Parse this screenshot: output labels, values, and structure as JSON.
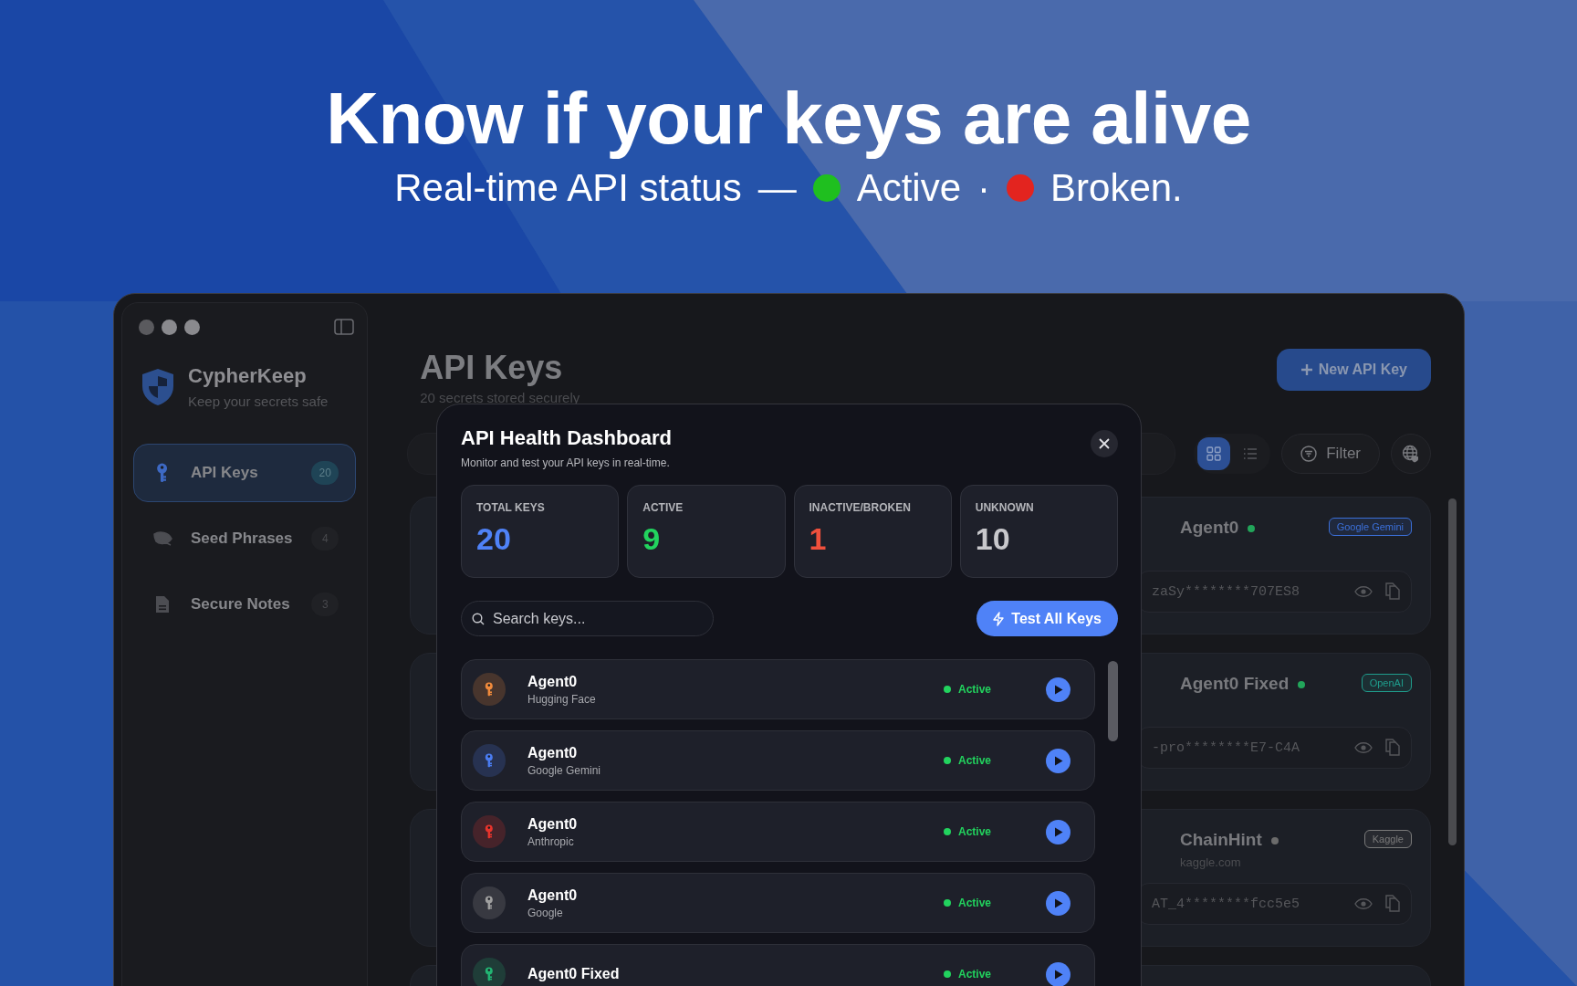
{
  "hero": {
    "title": "Know if your keys are alive",
    "subtitle": "Real-time API status",
    "dash": "—",
    "separator": "·",
    "statuses": [
      {
        "label": "Active",
        "color": "#1fbf1f"
      },
      {
        "label": "Broken.",
        "color": "#e3241f"
      }
    ]
  },
  "sidebar": {
    "app_name": "CypherKeep",
    "tagline": "Keep your secrets safe",
    "items": [
      {
        "label": "API Keys",
        "count": "20",
        "selected": true,
        "kind": "key"
      },
      {
        "label": "Seed Phrases",
        "count": "4",
        "selected": false,
        "kind": "leaf"
      },
      {
        "label": "Secure Notes",
        "count": "3",
        "selected": false,
        "kind": "note"
      }
    ]
  },
  "main": {
    "title": "API Keys",
    "subtitle": "20 secrets stored securely",
    "new_button": "New API Key",
    "filter_button": "Filter",
    "view_modes": [
      {
        "kind": "grid",
        "selected": true
      },
      {
        "kind": "list",
        "selected": false
      }
    ],
    "cards": [
      {
        "name": "Agent0",
        "color": "#22a55a",
        "tag": {
          "label": "Google Gemini",
          "color": "#3b6fd8"
        },
        "key_masked": "zaSy********707ES8"
      },
      {
        "name": "Agent0 Fixed",
        "color": "#22a55a",
        "tag": {
          "label": "OpenAI",
          "color": "#1f9c8c"
        },
        "key_masked": "-pro********E7-C4A"
      },
      {
        "name": "ChainHint",
        "color": "#6b6b6b",
        "tag": {
          "label": "Kaggle",
          "color": "#7a7a7a"
        },
        "url": "kaggle.com",
        "key_masked": "AT_4********fcc5e5"
      }
    ]
  },
  "modal": {
    "title": "API Health Dashboard",
    "subtitle": "Monitor and test your API keys in real-time.",
    "stats": [
      {
        "label": "TOTAL KEYS",
        "value": "20",
        "kind": "total"
      },
      {
        "label": "ACTIVE",
        "value": "9",
        "kind": "active"
      },
      {
        "label": "INACTIVE/BROKEN",
        "value": "1",
        "kind": "broken"
      },
      {
        "label": "UNKNOWN",
        "value": "10",
        "kind": "unknown"
      }
    ],
    "search": {
      "placeholder": "Search keys..."
    },
    "test_button": "Test All Keys",
    "keys": [
      {
        "name": "Agent0",
        "provider": "Hugging Face",
        "color": "#f08a3c",
        "status": "Active",
        "kind": "active"
      },
      {
        "name": "Agent0",
        "provider": "Google Gemini",
        "color": "#4a7cf0",
        "status": "Active",
        "kind": "active"
      },
      {
        "name": "Agent0",
        "provider": "Anthropic",
        "color": "#e8342c",
        "status": "Active",
        "kind": "active"
      },
      {
        "name": "Agent0",
        "provider": "Google",
        "color": "#a0a0a0",
        "status": "Active",
        "kind": "active"
      },
      {
        "name": "Agent0 Fixed",
        "color": "#22b573",
        "status": "Active",
        "kind": "active"
      }
    ]
  }
}
